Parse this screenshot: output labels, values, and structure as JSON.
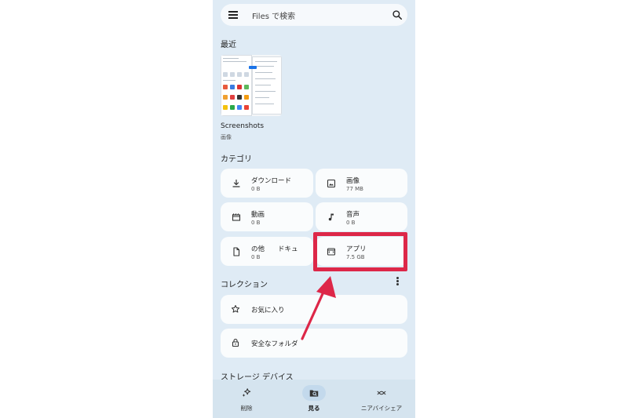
{
  "search": {
    "placeholder": "Files で検索"
  },
  "recent": {
    "title": "最近",
    "item": {
      "name": "Screenshots",
      "type": "画像"
    }
  },
  "categories": {
    "title": "カテゴリ",
    "items": [
      {
        "label": "ダウンロード",
        "size": "0 B",
        "icon": "download-icon"
      },
      {
        "label": "画像",
        "size": "77 MB",
        "icon": "image-icon"
      },
      {
        "label": "動画",
        "size": "0 B",
        "icon": "video-icon"
      },
      {
        "label": "音声",
        "size": "0 B",
        "icon": "music-note-icon"
      },
      {
        "label": "の他　　ドキュ",
        "size": "0 B",
        "icon": "document-icon"
      },
      {
        "label": "アプリ",
        "size": "7.5 GB",
        "icon": "app-icon"
      }
    ]
  },
  "collections": {
    "title": "コレクション",
    "items": [
      {
        "label": "お気に入り",
        "icon": "star-icon"
      },
      {
        "label": "安全なフォルダ",
        "icon": "lock-icon"
      }
    ]
  },
  "storage": {
    "title": "ストレージ デバイス"
  },
  "bottom_nav": [
    {
      "label": "削除",
      "icon": "sparkle-icon",
      "active": false
    },
    {
      "label": "見る",
      "icon": "browse-icon",
      "active": true
    },
    {
      "label": "ニアバイシェア",
      "icon": "nearby-share-icon",
      "active": false
    }
  ],
  "annotation": {
    "color": "#dd2748"
  },
  "colors": {
    "background": "#dfebf5",
    "card": "#fafcfd",
    "nav": "#d5e4ef"
  }
}
